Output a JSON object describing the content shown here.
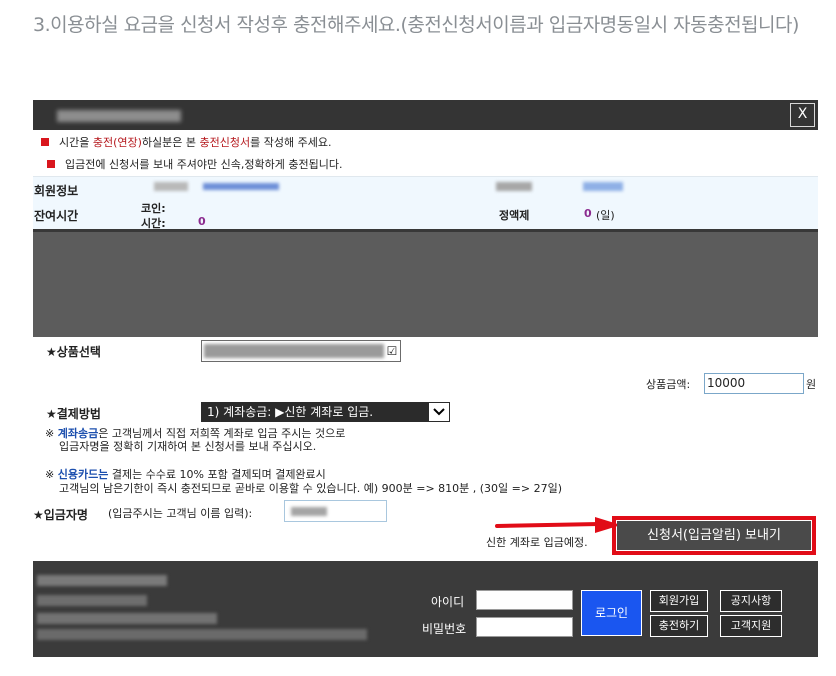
{
  "heading": "3.이용하실 요금을 신청서 작성후 충전해주세요.(충전신청서이름과 입금자명동일시 자동충전됩니다)",
  "dialog": {
    "close_label": "X",
    "notice1": {
      "a": "시간을 ",
      "b": "충전(연장)",
      "c": "하실분은  본  ",
      "d": "충전신청서",
      "e": "를 작성해 주세요."
    },
    "notice2": "입금전에 신청서를 보내 주셔야만 신속,정확하게 충전됩니다.",
    "member_info_label": "회원정보",
    "remaining_label": "잔여시간",
    "coin_label": "코인:",
    "time_label": "시간:",
    "time_value": "0",
    "fixed_label": "정액제",
    "fixed_value": "0",
    "fixed_unit": "(일)",
    "product_label": "★상품선택",
    "amount_label": "상품금액:",
    "amount_value": "10000",
    "amount_unit": "원",
    "payment_label": "★결제방법",
    "payment_selected": "1) 계좌송금: ▶신한 계좌로 입금.",
    "transfer_note": {
      "mark": "※ ",
      "kw": "계좌송금",
      "rest": "은 고객님께서  직접 저희쪽 계좌로 입금 주시는 것으로",
      "line2": "입금자명을 정확히 기재하여   본  신청서를  보내 주십시오."
    },
    "card_note": {
      "mark": "※ ",
      "kw": "신용카드는",
      "rest": " 결제는 수수료 10% 포함 결제되며 결제완료시",
      "line2": "고객님의 남은기한이 즉시 충전되므로 곧바로 이용할 수 있습니다. 예) 900분 => 810분 , (30일 => 27일)"
    },
    "depositor_label": "★입금자명",
    "depositor_hint": "(입금주시는 고객님 이름 입력):",
    "bank_note": "신한 계좌로 입금예정.",
    "send_label": "신청서(입금알림) 보내기"
  },
  "footer": {
    "id_label": "아이디",
    "pw_label": "비밀번호",
    "login_label": "로그인",
    "join_label": "회원가입",
    "notice_label": "공지사항",
    "charge_label": "충전하기",
    "support_label": "고객지원"
  },
  "colors": {
    "accent_red": "#e10c17",
    "login_blue": "#1a56f0",
    "purple": "#8b2b8f",
    "dark_bar": "#343434"
  }
}
